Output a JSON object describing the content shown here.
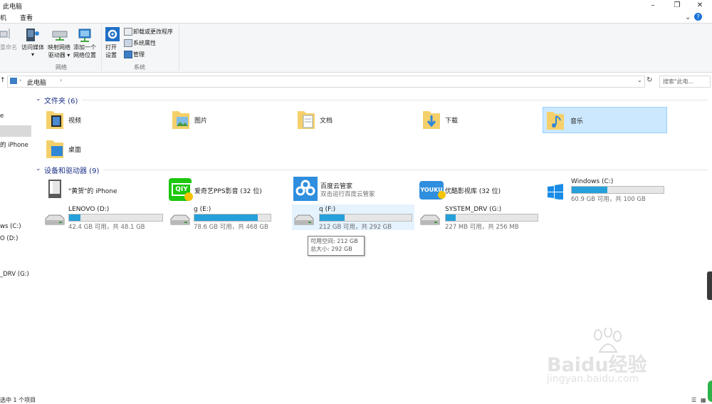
{
  "window": {
    "title": "此电脑"
  },
  "tabs": [
    "机",
    "查看"
  ],
  "ribbon": {
    "rename": "重命名",
    "access_media": "访问媒体",
    "map_drive_line1": "映射网络",
    "map_drive_line2": "驱动器",
    "add_location_line1": "添加一个",
    "add_location_line2": "网络位置",
    "network_group": "网络",
    "open_settings_line1": "打开",
    "open_settings_line2": "设置",
    "uninstall": "卸载或更改程序",
    "sys_props": "系统属性",
    "manage": "管理",
    "system_group": "系统"
  },
  "address": {
    "path": "此电脑",
    "search_placeholder": "搜索\"此电..."
  },
  "nav_pane": [
    "e",
    "的 iPhone",
    "ws (C:)",
    "O (D:)",
    "_DRV (G:)"
  ],
  "folders_title": "文件夹 (6)",
  "folders": [
    "视频",
    "图片",
    "文档",
    "下载",
    "音乐",
    "桌面"
  ],
  "devices_title": "设备和驱动器 (9)",
  "devices": [
    {
      "name": "\"黄贺\"的 iPhone"
    },
    {
      "name": "爱奇艺PPS影音 (32 位)"
    },
    {
      "name": "百度云管家",
      "sub": "双击运行百度云管家"
    },
    {
      "name": "优酷影视库 (32 位)"
    },
    {
      "name": "Windows (C:)",
      "sub": "60.9 GB 可用，共 100 GB",
      "fill": 0.39
    },
    {
      "name": "LENOVO (D:)",
      "sub": "42.4 GB 可用，共 48.1 GB",
      "fill": 0.12
    },
    {
      "name": "g (E:)",
      "sub": "78.6 GB 可用，共 468 GB",
      "fill": 0.83
    },
    {
      "name": "q (F:)",
      "sub": "212 GB 可用，共 292 GB",
      "fill": 0.27
    },
    {
      "name": "SYSTEM_DRV (G:)",
      "sub": "227 MB 可用，共 256 MB",
      "fill": 0.11
    }
  ],
  "tooltip": {
    "free": "可用空间: 212 GB",
    "total": "总大小: 292 GB"
  },
  "status": "选中 1 个项目",
  "watermark": {
    "brand": "Baidu经验",
    "url": "jingyan.baidu.com"
  }
}
